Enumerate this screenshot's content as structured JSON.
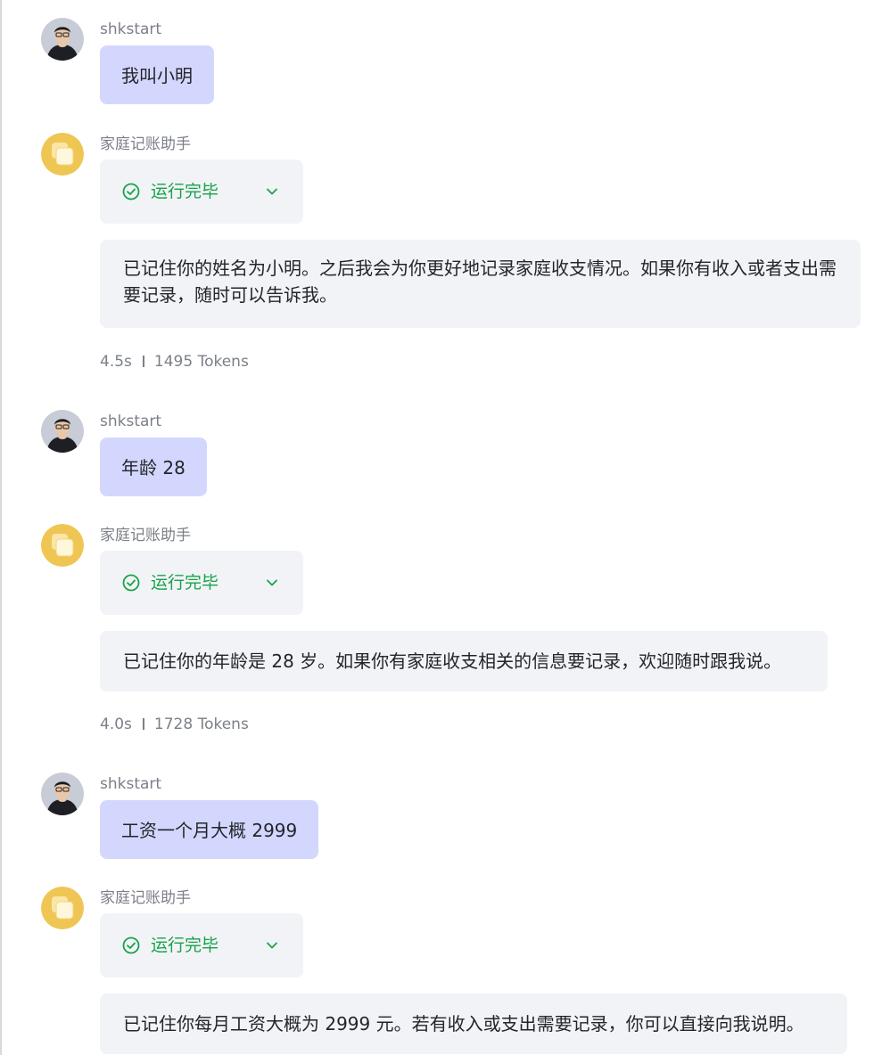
{
  "messages": [
    {
      "role": "user",
      "sender": "shkstart",
      "text": "我叫小明"
    },
    {
      "role": "assistant",
      "sender": "家庭记账助手",
      "status": "运行完毕",
      "text": "已记住你的姓名为小明。之后我会为你更好地记录家庭收支情况。如果你有收入或者支出需要记录，随时可以告诉我。",
      "duration": "4.5s",
      "tokens": "1495 Tokens"
    },
    {
      "role": "user",
      "sender": "shkstart",
      "text": "年龄 28"
    },
    {
      "role": "assistant",
      "sender": "家庭记账助手",
      "status": "运行完毕",
      "text": "已记住你的年龄是 28 岁。如果你有家庭收支相关的信息要记录，欢迎随时跟我说。",
      "duration": "4.0s",
      "tokens": "1728 Tokens"
    },
    {
      "role": "user",
      "sender": "shkstart",
      "text": "工资一个月大概 2999"
    },
    {
      "role": "assistant",
      "sender": "家庭记账助手",
      "status": "运行完毕",
      "text": "已记住你每月工资大概为 2999 元。若有收入或支出需要记录，你可以直接向我说明。"
    }
  ],
  "colors": {
    "user_bubble": "#d4d7fd",
    "assistant_bubble": "#f2f3f6",
    "status_success": "#17a34a"
  },
  "icons": {
    "user_avatar": "user-avatar-photo",
    "assistant_avatar": "assistant-avatar-icon",
    "status": "check-circle-icon",
    "expand": "chevron-down-icon"
  }
}
